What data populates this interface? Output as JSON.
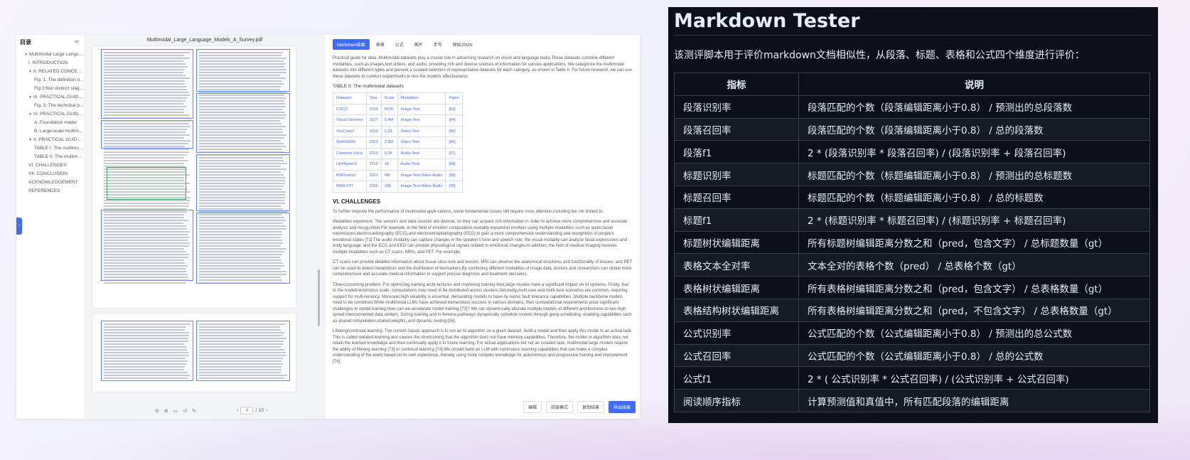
{
  "left": {
    "toc_title": "目录",
    "toc_collapse": "≪",
    "toc_items": [
      {
        "label": "Multimodal Large Langua...",
        "level": 0,
        "caret": true
      },
      {
        "label": "I. INTRODUCTION",
        "level": 1,
        "caret": false
      },
      {
        "label": "II. RELATED CONCEPTS",
        "level": 1,
        "caret": true
      },
      {
        "label": "Fig. 1: The definition o...",
        "level": 2,
        "caret": false
      },
      {
        "label": "Fig 2:four distinct stag...",
        "level": 2,
        "caret": false
      },
      {
        "label": "III. PRACTICAL GUIDE F...",
        "level": 1,
        "caret": true
      },
      {
        "label": "Fig. 3: The technical p...",
        "level": 2,
        "caret": false
      },
      {
        "label": "IV. PRACTICAL GUIDE F...",
        "level": 1,
        "caret": true
      },
      {
        "label": "A. Foundation model",
        "level": 2,
        "caret": false
      },
      {
        "label": "B. Large-scale multim...",
        "level": 2,
        "caret": false
      },
      {
        "label": "V. PRACTICAL GUIDE F...",
        "level": 1,
        "caret": true
      },
      {
        "label": "TABLE I: The multimod...",
        "level": 2,
        "caret": false
      },
      {
        "label": "TABLE II: The multimo...",
        "level": 2,
        "caret": false
      },
      {
        "label": "VI. CHALLENGES",
        "level": 1,
        "caret": false
      },
      {
        "label": "VII. CONCLUSION",
        "level": 1,
        "caret": false
      },
      {
        "label": "ACKNOWLEDGEMENT",
        "level": 1,
        "caret": false
      },
      {
        "label": "REFERENCES",
        "level": 1,
        "caret": false
      }
    ],
    "pdf_title": "Multimodal_Large_Language_Models_A_Survey.pdf",
    "pager_current": "0",
    "pager_total": "/ 10",
    "tabs": [
      "Markdown结果",
      "表格",
      "公式",
      "图片",
      "手写",
      "原始JSON"
    ],
    "md_intro": "Practical guide for data. Multimodal datasets play a crucial role in advancing research on vision and language tasks.These datasets combine different modalities, such as images,text,videos, and audio, providing rich and diverse sources of information for various applications. We categorize the multimodal datasets into different types and present a curated selection of representative datasets for each category, as shown in Table II. For future research, we can use these datasets to conduct experiments to test the model's effectiveness.",
    "md_table_caption": "TABLE II: The multimodal datasets",
    "md_table_headers": [
      "Datasets",
      "Year",
      "Scale",
      "Modalities",
      "Paper"
    ],
    "md_table_rows": [
      [
        "COCO",
        "2014",
        "567K",
        "Image-Text",
        "[63]"
      ],
      [
        "Visual Genome",
        "2017",
        "5.4M",
        "Image-Text",
        "[64]"
      ],
      [
        "YouCook2",
        "2018",
        "2.2K",
        "Video-Text",
        "[65]"
      ],
      [
        "WebVid2M",
        "2021",
        "2.5M",
        "Video-Text",
        "[66]"
      ],
      [
        "Common Voice",
        "2019",
        "9.2K",
        "Audio-Text",
        "[67]"
      ],
      [
        "LibriSpeech",
        "2015",
        "1K",
        "Audio-Text",
        "[68]"
      ],
      [
        "MSProduct",
        "2021",
        "6M",
        "Image-Text-Video-Audio",
        "[69]"
      ],
      [
        "MSR-VTT",
        "2016",
        "10K",
        "Image-Text-Video-Audio",
        "[70]"
      ]
    ],
    "md_heading": "VI. CHALLENGES",
    "md_paragraphs": [
      "To further improve the performance of multimodal appli-cations, some fundamental issues still require more attention,including but not limited to:",
      "Modalities expansion. The sensors and data sources are diverse, so they can acquire rich information in order to achieve more comprehensive and accurate analysis and recog-nition.For example, in the field of emotion computation,modality expansion involves using multiple modalities such as audio,facial expressions,electrocardiography (ECG),and electroencephalography (EEG) to gain a more comprehensive understanding and recognition of people's emotional states [71].The audio modality can capture changes in the speaker's tone and speech rate; the visual modality can analyze facial expressions and body language; and the ECG and EEG can provide physiological signals related to emotional changes.In addition, the field of medical imaging involves multiple modalities such as CT scans, MRIs, and PET. For example,",
      "CT scans can provide detailed information about tissue struc-ture and lesions; MRI can observe the anatomical structures and functionality of tissues; and PET can be used to detect metabolism and the distribution of biomarkers.By combining different modalities of image data, doctors and researchers can obtain more comprehensive and accurate medical information to support precise diagnosis and treatment decisions.",
      "Time-consuming problem. For optimizing training archi-tectures and improving training time,large models have a significant impact on AI systems. Firstly, due to the models'enormous scale, computations may need to be distributed across clusters.Secondly,multi-user and multi-task scenarios are common, requiring support for multi-tenancy. Moreover,high reliability is essential, demanding models to have dy-namic fault tolerance capabilities. Multiple backbone models need to be combined.While multimodal LLMs have achieved tremendous success in various domains, their computational requirements pose significant challenges to model training.How can we accelerate model training [72]? We can dynami-cally allocate multiple models of different architectures to two high-speed interconnected data centers. During training and in-ference,pathways dynamically schedule models through gang-scheduling, enabling capabilities such as shared computation,shared weights, and dynamic routing [26].",
      "Lifelong/continual learning. The current classic approach is to run an AI algorithm on a given dataset, build a model,and then apply this model to an actual task. This is called isolated learning and causes the shortcoming that the algorithm does not have memory capabilities. Therefore, the model or algorithm does not retain the learned knowledge and then continually apply it to future learning. For actual applications but not an isolated task, multimodal large models require the ability of lifelong learning [73] or continual learning [74].We should build an LLM with continuous learning capabilities that can make a complex understanding of the world based on its own experience, thereby using more complex knowledge for autonomous and progressive training and improvement [74]."
    ],
    "bottom_buttons": [
      "编辑",
      "阅读模式",
      "复制结果",
      "导出结果"
    ]
  },
  "right": {
    "title": "Markdown Tester",
    "description": "该测评脚本用于评价markdown文档相似性，从段落、标题、表格和公式四个维度进行评价：",
    "headers": [
      "指标",
      "说明"
    ],
    "rows": [
      [
        "段落识别率",
        "段落匹配的个数（段落编辑距离小于0.8） / 预测出的总段落数"
      ],
      [
        "段落召回率",
        "段落匹配的个数（段落编辑距离小于0.8） / 总的段落数"
      ],
      [
        "段落f1",
        "2 * (段落识别率 * 段落召回率) / (段落识别率 + 段落召回率)"
      ],
      [
        "标题识别率",
        "标题匹配的个数（标题编辑距离小于0.8） / 预测出的总标题数"
      ],
      [
        "标题召回率",
        "标题匹配的个数（标题编辑距离小于0.8） / 总的标题数"
      ],
      [
        "标题f1",
        "2 * (标题识别率 * 标题召回率) / (标题识别率 + 标题召回率)"
      ],
      [
        "标题树状编辑距离",
        "所有标题树编辑距离分数之和（pred，包含文字） / 总标题数量（gt）"
      ],
      [
        "表格文本全对率",
        "文本全对的表格个数（pred） / 总表格个数（gt）"
      ],
      [
        "表格树状编辑距离",
        "所有表格树编辑距离分数之和（pred，包含文字） / 总表格数量（gt）"
      ],
      [
        "表格结构树状编辑距离",
        "所有表格树编辑距离分数之和（pred，不包含文字） / 总表格数量（gt）"
      ],
      [
        "公式识别率",
        "公式匹配的个数（公式编辑距离小于0.8） / 预测出的总公式数"
      ],
      [
        "公式召回率",
        "公式匹配的个数（公式编辑距离小于0.8） / 总的公式数"
      ],
      [
        "公式f1",
        "2 * ( 公式识别率 * 公式召回率) / (公式识别率 + 公式召回率)"
      ],
      [
        "阅读顺序指标",
        "计算预测值和真值中，所有匹配段落的编辑距离"
      ]
    ]
  }
}
